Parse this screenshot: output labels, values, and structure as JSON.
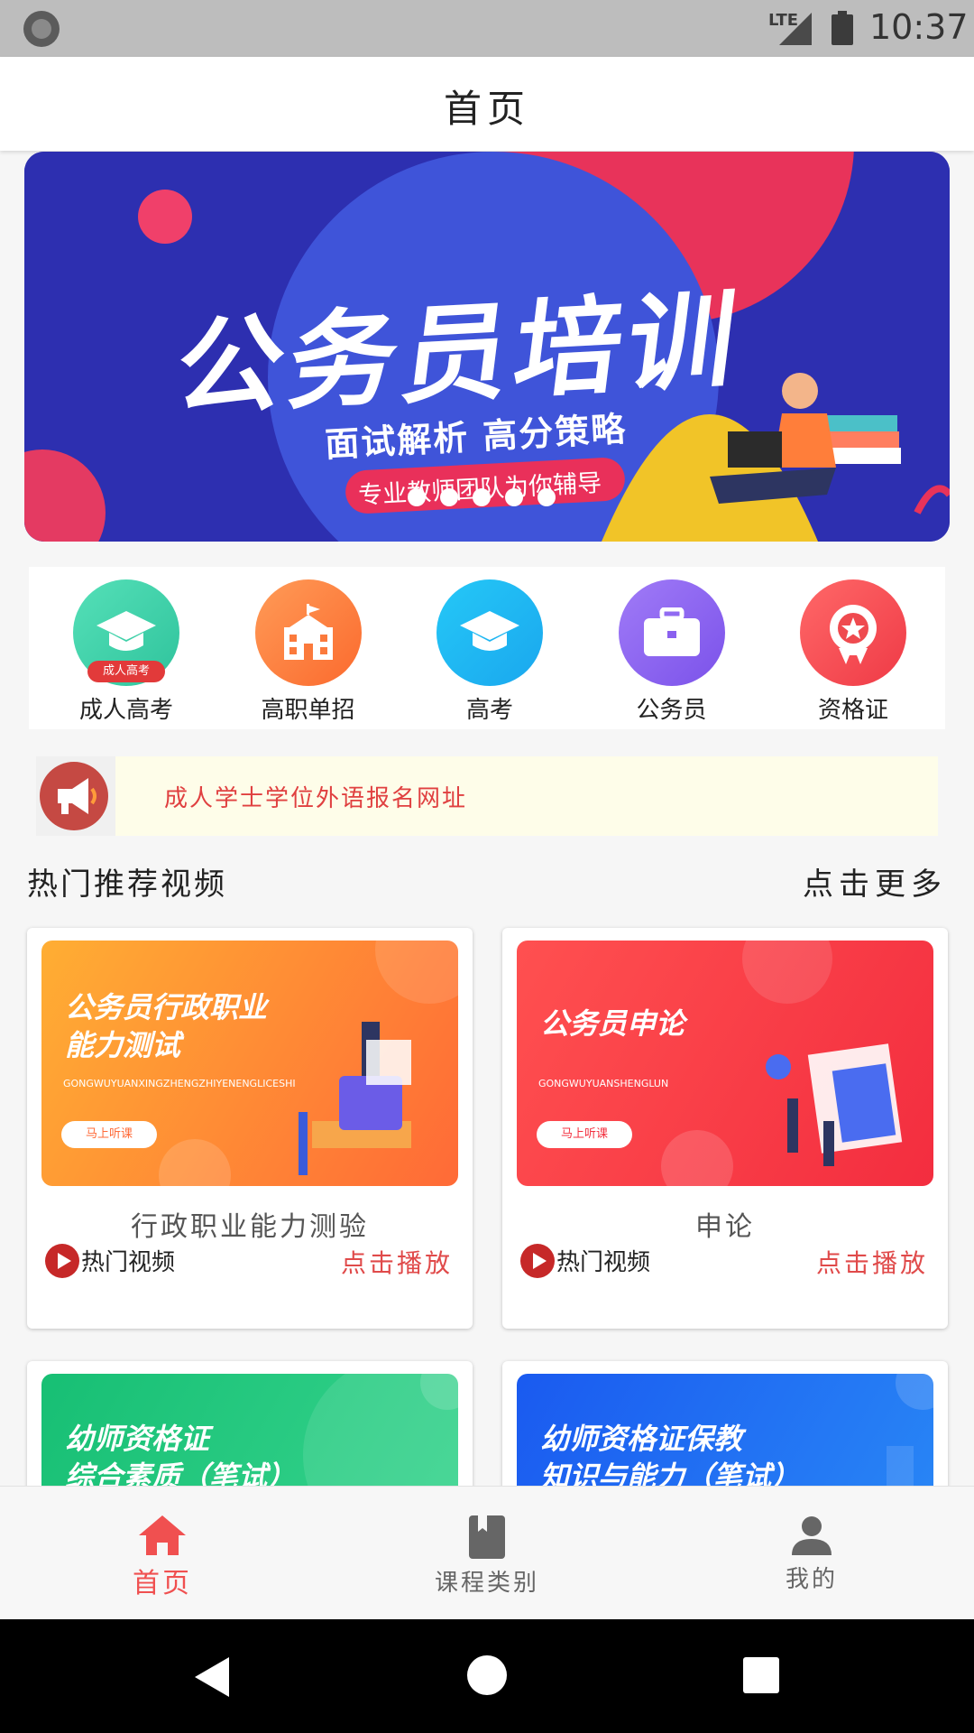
{
  "status_bar": {
    "time": "10:37",
    "network": "LTE"
  },
  "appbar": {
    "title": "首页"
  },
  "banner": {
    "title": "公务员培训",
    "subtitle": "面试解析 高分策略",
    "pill": "专业教师团队为你辅导",
    "dot_count": 5
  },
  "categories": [
    {
      "label": "成人高考",
      "icon": "graduation-cap-icon",
      "tag": "成人高考",
      "color": "#3fcfa5"
    },
    {
      "label": "高职单招",
      "icon": "school-building-icon",
      "color": "#fb7a3c"
    },
    {
      "label": "高考",
      "icon": "graduation-cap-icon",
      "color": "#1fb8f2"
    },
    {
      "label": "公务员",
      "icon": "briefcase-icon",
      "color": "#9266f0"
    },
    {
      "label": "资格证",
      "icon": "award-badge-icon",
      "color": "#f24a4f"
    }
  ],
  "notice": {
    "text": "成人学士学位外语报名网址",
    "icon": "megaphone-icon"
  },
  "section": {
    "title": "热门推荐视频",
    "more": "点击更多"
  },
  "cards": [
    {
      "thumb_title_1": "公务员行政职业",
      "thumb_title_2": "能力测试",
      "thumb_pinyin": "GONGWUYUANXINGZHENGZHIYENENGLICESHI",
      "thumb_button": "马上听课",
      "name": "行政职业能力测验",
      "hot": "热门视频",
      "action": "点击播放",
      "colors": [
        "#ff9a2e",
        "#ff6a3a"
      ]
    },
    {
      "thumb_title_1": "公务员申论",
      "thumb_title_2": "",
      "thumb_pinyin": "GONGWUYUANSHENGLUN",
      "thumb_button": "马上听课",
      "name": "申论",
      "hot": "热门视频",
      "action": "点击播放",
      "colors": [
        "#ff4a4a",
        "#f22a3a"
      ]
    },
    {
      "thumb_title_1": "幼师资格证",
      "thumb_title_2": "综合素质（笔试）",
      "colors": [
        "#1ec27a",
        "#3ad690"
      ]
    },
    {
      "thumb_title_1": "幼师资格证保教",
      "thumb_title_2": "知识与能力（笔试）",
      "colors": [
        "#1a5ff0",
        "#2a86f5"
      ]
    }
  ],
  "bottom_nav": [
    {
      "label": "首页",
      "icon": "home-icon",
      "active": true
    },
    {
      "label": "课程类别",
      "icon": "book-icon",
      "active": false
    },
    {
      "label": "我的",
      "icon": "person-icon",
      "active": false
    }
  ],
  "colors": {
    "accent": "#f05050",
    "banner_bg": "#2f2fb4"
  }
}
